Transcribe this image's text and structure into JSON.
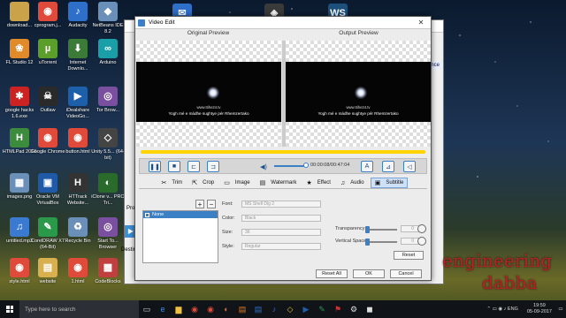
{
  "desktop": {
    "icons": [
      {
        "label": "download...",
        "glyph": "",
        "color": "#c9a24a"
      },
      {
        "label": "cprogram.j...",
        "glyph": "◉",
        "color": "#e04a3a"
      },
      {
        "label": "Audacity",
        "glyph": "♪",
        "color": "#2d6fc9"
      },
      {
        "label": "NetBeans IDE 8.2",
        "glyph": "◆",
        "color": "#6a8fb8"
      },
      {
        "label": "FL Studio 12",
        "glyph": "❀",
        "color": "#e08a2a"
      },
      {
        "label": "uTorrent",
        "glyph": "µ",
        "color": "#5b9f2a"
      },
      {
        "label": "Internet Downlo...",
        "glyph": "⬇",
        "color": "#3c7a38"
      },
      {
        "label": "Arduino",
        "glyph": "∞",
        "color": "#1a9fa8"
      },
      {
        "label": "google hacks 1.6.exe",
        "glyph": "✱",
        "color": "#cc2222"
      },
      {
        "label": "Outlaw",
        "glyph": "☠",
        "color": "#2a2a2a"
      },
      {
        "label": "iDealshare VideoGo...",
        "glyph": "▶",
        "color": "#1d5fa8"
      },
      {
        "label": "Tor Brow...",
        "glyph": "◎",
        "color": "#7b4fa0"
      },
      {
        "label": "HTMLPad 2016",
        "glyph": "H",
        "color": "#3d8b3d"
      },
      {
        "label": "Google Chrome",
        "glyph": "◉",
        "color": "#e04a3a"
      },
      {
        "label": "button.html",
        "glyph": "◉",
        "color": "#e04a3a"
      },
      {
        "label": "Unity 5.5... (64-bit)",
        "glyph": "◇",
        "color": "#444"
      },
      {
        "label": "images.png",
        "glyph": "▦",
        "color": "#6a8fb8"
      },
      {
        "label": "Oracle VM VirtualBox",
        "glyph": "▣",
        "color": "#1e5aa8"
      },
      {
        "label": "HTTrack Website...",
        "glyph": "H",
        "color": "#333"
      },
      {
        "label": "iClone v... PRO Tri...",
        "glyph": "◐",
        "color": "#2a6a2a"
      },
      {
        "label": "untitled.mp3",
        "glyph": "♫",
        "color": "#3a7ad0"
      },
      {
        "label": "CorelDRAW X7 (64-Bit)",
        "glyph": "✎",
        "color": "#2a9a4a"
      },
      {
        "label": "Recycle Bin",
        "glyph": "♻",
        "color": "#6a8fb8"
      },
      {
        "label": "Start To... Browser",
        "glyph": "◎",
        "color": "#7b4fa0"
      },
      {
        "label": "style.html",
        "glyph": "◉",
        "color": "#e04a3a"
      },
      {
        "label": "website",
        "glyph": "▤",
        "color": "#d9b050"
      },
      {
        "label": "1.html",
        "glyph": "◉",
        "color": "#e04a3a"
      },
      {
        "label": "CodeBlocks",
        "glyph": "▩",
        "color": "#c04040"
      }
    ],
    "topbar_icons": [
      {
        "glyph": "✉",
        "color": "#2f6fc8"
      },
      {
        "glyph": "◈",
        "color": "#3a3a3a"
      },
      {
        "glyph": "WS",
        "color": "#1c4f7a"
      }
    ]
  },
  "background_window": {
    "side_label": "Profile",
    "dest_label": "Destin",
    "button_glyph": "▶",
    "ref_label": "erence",
    "extra_label": "begin..."
  },
  "dialog": {
    "title": "Video Edit",
    "close_glyph": "✕",
    "original_preview_label": "Original Preview",
    "output_preview_label": "Output Preview",
    "subtitle_line1": "Yogh mé e mádhe sughtye pér Rhemzertako",
    "subtitle_line2": "www.ttihe24.tv",
    "timecode": "00:00:08/00:47:04",
    "progress_percent": 100,
    "volume_percent": 70,
    "tabs": [
      {
        "label": "Trim",
        "icon": "✂"
      },
      {
        "label": "Crop",
        "icon": "⇱"
      },
      {
        "label": "Image",
        "icon": "▭"
      },
      {
        "label": "Watermark",
        "icon": "▤"
      },
      {
        "label": "Effect",
        "icon": "★"
      },
      {
        "label": "Audio",
        "icon": "♫"
      },
      {
        "label": "Subtitle",
        "icon": "▣"
      }
    ],
    "active_tab": "Subtitle",
    "subtitle_panel": {
      "list_item": "None",
      "add_glyph": "+",
      "remove_glyph": "−",
      "font_label": "Font:",
      "font_value": "MS Shell Dlg 2",
      "color_label": "Color:",
      "color_value": "Black",
      "size_label": "Size:",
      "size_value": "36",
      "style_label": "Style:",
      "style_value": "Regular",
      "transparency_label": "Transparency:",
      "transparency_value": "0",
      "vertical_space_label": "Vertical Space:",
      "vertical_space_value": "0",
      "reset_label": "Reset"
    },
    "footer": {
      "reset_all": "Reset All",
      "ok": "OK",
      "cancel": "Cancel"
    }
  },
  "brand": {
    "line1": "engineering",
    "line2": "dabba"
  },
  "taskbar": {
    "search_placeholder": "Type here to search",
    "apps": [
      {
        "glyph": "▭",
        "color": "#cfd6df"
      },
      {
        "glyph": "e",
        "color": "#3a8ee6"
      },
      {
        "glyph": "▆",
        "color": "#f0c040"
      },
      {
        "glyph": "◉",
        "color": "#e04a3a"
      },
      {
        "glyph": "◉",
        "color": "#e04a3a"
      },
      {
        "glyph": "◐",
        "color": "#e06a2a"
      },
      {
        "glyph": "▤",
        "color": "#e07a20"
      },
      {
        "glyph": "▤",
        "color": "#2f6fc8"
      },
      {
        "glyph": "♪",
        "color": "#2d6fc9"
      },
      {
        "glyph": "◇",
        "color": "#e0c040"
      },
      {
        "glyph": "▶",
        "color": "#1d5fa8"
      },
      {
        "glyph": "✎",
        "color": "#2a9a4a"
      },
      {
        "glyph": "⚑",
        "color": "#cc3333"
      },
      {
        "glyph": "⚙",
        "color": "#ddd"
      },
      {
        "glyph": "◼",
        "color": "#ddd"
      }
    ],
    "tray_glyphs": "⌃ ▭ ◉ ♪ ENG",
    "time": "19:59",
    "date": "05-09-2017"
  }
}
